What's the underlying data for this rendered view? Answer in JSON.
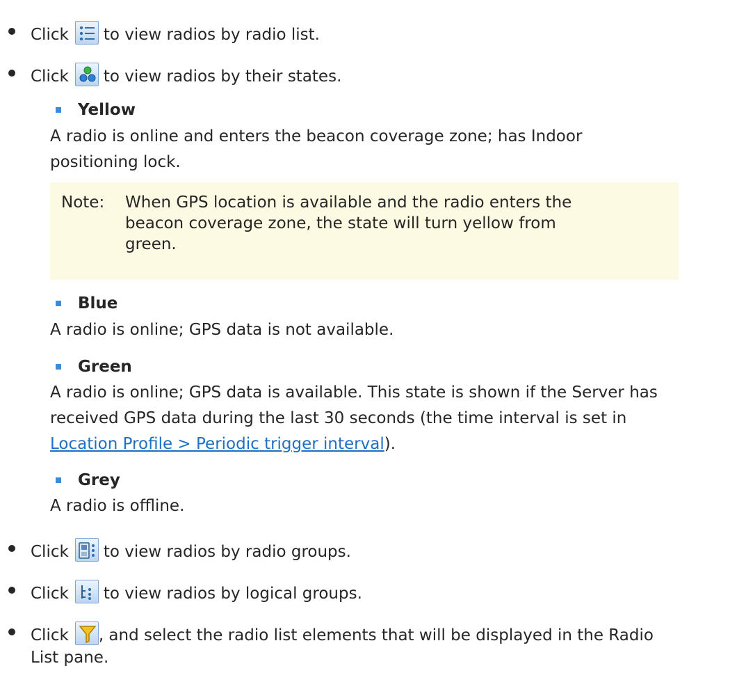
{
  "click_word": "Click",
  "items": [
    {
      "icon": "radio-list-icon",
      "text": "to view radios by radio list."
    },
    {
      "icon": "radio-states-icon",
      "text": "to view radios by their states."
    },
    {
      "icon": "radio-groups-icon",
      "text": "to view radios by radio groups."
    },
    {
      "icon": "logical-groups-icon",
      "text": "to view radios by logical groups."
    },
    {
      "icon": "filter-icon",
      "text_line1": ", and select the radio list elements that will be displayed in the Radio",
      "text_line2": "List pane."
    }
  ],
  "states": {
    "yellow": {
      "title": "Yellow",
      "desc_line1": "A radio is online and enters the beacon coverage zone; has Indoor",
      "desc_line2": "positioning lock."
    },
    "note": {
      "label": "Note:",
      "line1": "When GPS location is available and the radio enters the",
      "line2": "beacon coverage zone, the state will turn yellow from",
      "line3": "green."
    },
    "blue": {
      "title": "Blue",
      "desc": "A radio is online; GPS data is not available."
    },
    "green": {
      "title": "Green",
      "desc_line1": "A radio is online; GPS data is available. This state is shown if the Server has",
      "desc_line2": "received GPS data during the last 30 seconds (the time interval is set in",
      "link": "Location Profile > Periodic trigger interval",
      "after_link": ")."
    },
    "grey": {
      "title": "Grey",
      "desc": "A radio is offline."
    }
  },
  "colors": {
    "text": "#262626",
    "sub_bullet": "#3a8cd9",
    "note_bg": "#fdfae4",
    "link": "#1f6fc6"
  }
}
